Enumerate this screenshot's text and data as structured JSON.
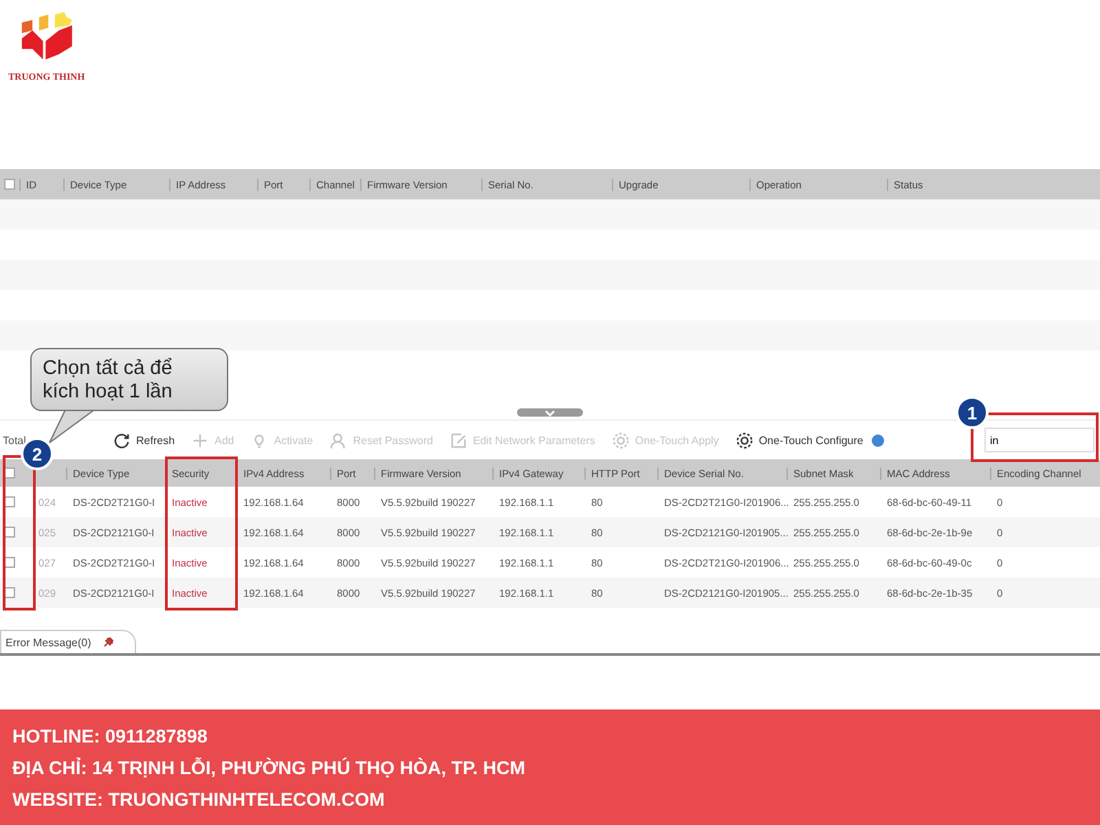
{
  "logo": {
    "text": "TRUONG THINH"
  },
  "upper_table": {
    "all_checked": false,
    "columns": [
      "ID",
      "Device Type",
      "IP Address",
      "Port",
      "Channel",
      "Firmware Version",
      "Serial No.",
      "Upgrade",
      "Operation",
      "Status"
    ]
  },
  "toolbar": {
    "total": "Total",
    "items": [
      {
        "kind": "refresh",
        "label": "Refresh",
        "disabled": false
      },
      {
        "kind": "add",
        "label": "Add",
        "disabled": true
      },
      {
        "kind": "activate",
        "label": "Activate",
        "disabled": true
      },
      {
        "kind": "reset",
        "label": "Reset Password",
        "disabled": true
      },
      {
        "kind": "edit",
        "label": "Edit Network Parameters",
        "disabled": true
      },
      {
        "kind": "apply",
        "label": "One-Touch Apply",
        "disabled": true
      },
      {
        "kind": "configure",
        "label": "One-Touch Configure",
        "disabled": false
      }
    ]
  },
  "search": {
    "value": "in"
  },
  "device_table": {
    "all_checked": false,
    "columns": [
      "",
      "Device Type",
      "Security",
      "IPv4 Address",
      "Port",
      "Firmware Version",
      "IPv4 Gateway",
      "HTTP Port",
      "Device Serial No.",
      "Subnet Mask",
      "MAC Address",
      "Encoding Channel"
    ],
    "rows": [
      {
        "checked": false,
        "cells": [
          "024",
          "DS-2CD2T21G0-I",
          "Inactive",
          "192.168.1.64",
          "8000",
          "V5.5.92build 190227",
          "192.168.1.1",
          "80",
          "DS-2CD2T21G0-I201906...",
          "255.255.255.0",
          "68-6d-bc-60-49-11",
          "0"
        ]
      },
      {
        "checked": false,
        "cells": [
          "025",
          "DS-2CD2121G0-I",
          "Inactive",
          "192.168.1.64",
          "8000",
          "V5.5.92build 190227",
          "192.168.1.1",
          "80",
          "DS-2CD2121G0-I201905...",
          "255.255.255.0",
          "68-6d-bc-2e-1b-9e",
          "0"
        ]
      },
      {
        "checked": false,
        "cells": [
          "027",
          "DS-2CD2T21G0-I",
          "Inactive",
          "192.168.1.64",
          "8000",
          "V5.5.92build 190227",
          "192.168.1.1",
          "80",
          "DS-2CD2T21G0-I201906...",
          "255.255.255.0",
          "68-6d-bc-60-49-0c",
          "0"
        ]
      },
      {
        "checked": false,
        "cells": [
          "029",
          "DS-2CD2121G0-I",
          "Inactive",
          "192.168.1.64",
          "8000",
          "V5.5.92build 190227",
          "192.168.1.1",
          "80",
          "DS-2CD2121G0-I201905...",
          "255.255.255.0",
          "68-6d-bc-2e-1b-35",
          "0"
        ]
      }
    ]
  },
  "callout": {
    "text": "Chọn tất cả để kích hoạt 1 lần"
  },
  "markers": [
    {
      "label": "1"
    },
    {
      "label": "2"
    }
  ],
  "bottom_tab": {
    "label": "Error Message(0)"
  },
  "footer": {
    "lines": [
      "HOTLINE: 0911287898",
      "ĐỊA CHỈ: 14 TRỊNH LỖI, PHƯỜNG PHÚ THỌ HÒA, TP. HCM",
      "WEBSITE: TRUONGTHINHTELECOM.COM"
    ]
  }
}
